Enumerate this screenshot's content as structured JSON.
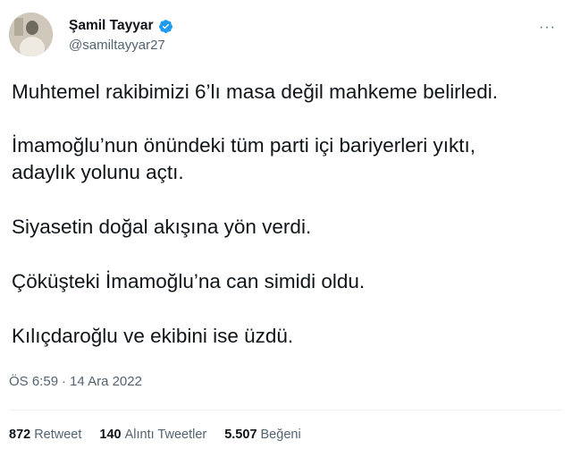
{
  "author": {
    "display_name": "Şamil Tayyar",
    "handle": "@samiltayyar27",
    "verified_color": "#1d9bf0"
  },
  "more_icon": "more-horizontal-icon",
  "tweet": {
    "paragraphs": [
      "Muhtemel rakibimizi 6’lı masa değil mahkeme belirledi.",
      "İmamoğlu’nun önündeki tüm parti içi bariyerleri yıktı,\nadaylık yolunu açtı.",
      "Siyasetin doğal akışına yön verdi.",
      "Çöküşteki İmamoğlu’na can simidi oldu.",
      "Kılıçdaroğlu ve ekibini ise üzdü."
    ]
  },
  "meta": {
    "time": "ÖS 6:59",
    "separator": "·",
    "date": "14 Ara 2022"
  },
  "stats": {
    "retweets": {
      "count": "872",
      "label": "Retweet"
    },
    "quotes": {
      "count": "140",
      "label": "Alıntı Tweetler"
    },
    "likes": {
      "count": "5.507",
      "label": "Beğeni"
    }
  }
}
